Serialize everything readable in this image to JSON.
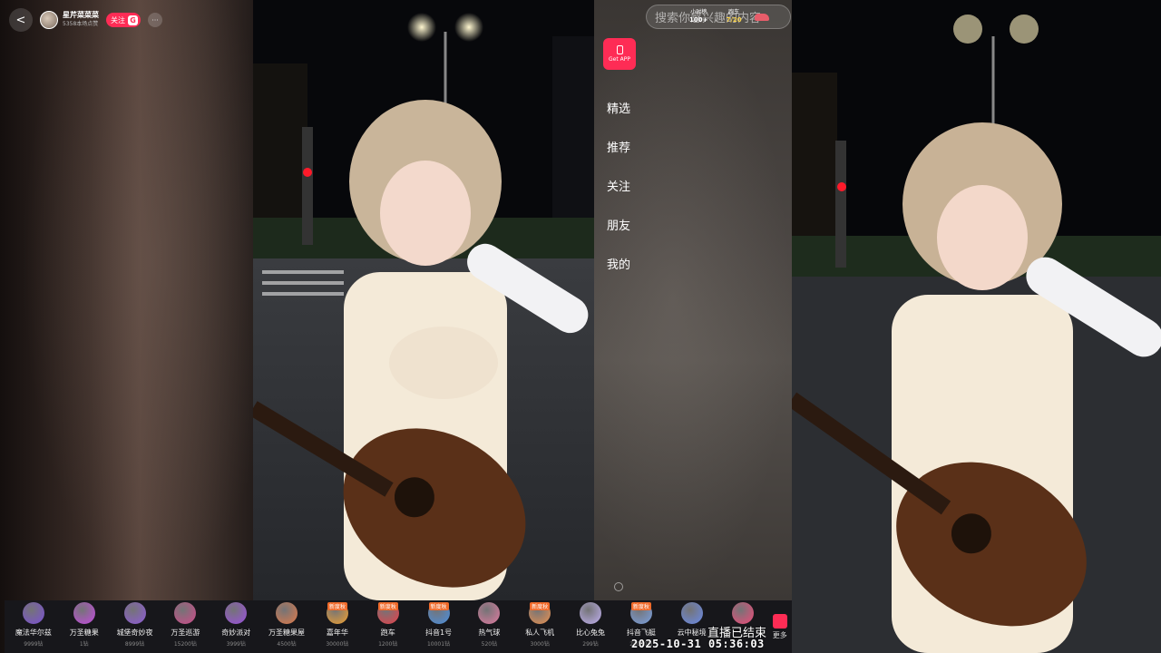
{
  "header": {
    "back": "<",
    "anchor_name": "星芹菜菜菜",
    "anchor_sub": "5358本场点赞",
    "follow_label": "关注",
    "follow_badge": "G",
    "more": "···"
  },
  "get_app": {
    "label": "Get APP"
  },
  "search": {
    "text": "搜索你感兴趣的内容"
  },
  "rank": {
    "hourly_label": "小时榜",
    "hourly_value": "100+",
    "team_label": "跑车",
    "team_value": "7/20"
  },
  "menu": {
    "items": [
      "精选",
      "推荐",
      "关注",
      "朋友",
      "我的"
    ]
  },
  "gifts": [
    {
      "name": "魔法华尔兹",
      "price": "9999钻",
      "tag": "",
      "color": "#7b4fd6"
    },
    {
      "name": "万圣糖果",
      "price": "1钻",
      "tag": "",
      "color": "#c54ae0"
    },
    {
      "name": "城堡奇妙夜",
      "price": "8999钻",
      "tag": "",
      "color": "#8f5ad9"
    },
    {
      "name": "万圣巡游",
      "price": "15200钻",
      "tag": "",
      "color": "#d04a8a"
    },
    {
      "name": "奇妙派对",
      "price": "3999钻",
      "tag": "",
      "color": "#9b4fe0"
    },
    {
      "name": "万圣糖果屋",
      "price": "4500钻",
      "tag": "",
      "color": "#e07a4a"
    },
    {
      "name": "嘉年华",
      "price": "30000钻",
      "tag": "新度秋",
      "color": "#f0a030"
    },
    {
      "name": "跑车",
      "price": "1200钻",
      "tag": "新度秋",
      "color": "#e8404a"
    },
    {
      "name": "抖音1号",
      "price": "10001钻",
      "tag": "新度秋",
      "color": "#4a8fe0"
    },
    {
      "name": "热气球",
      "price": "520钻",
      "tag": "",
      "color": "#e07aa0"
    },
    {
      "name": "私人飞机",
      "price": "3000钻",
      "tag": "新度秋",
      "color": "#e89050"
    },
    {
      "name": "比心兔兔",
      "price": "299钻",
      "tag": "",
      "color": "#c0b0f0"
    },
    {
      "name": "抖音飞艇",
      "price": "20000钻",
      "tag": "新度秋",
      "color": "#7aa0e0"
    },
    {
      "name": "云中秘境",
      "price": "",
      "tag": "",
      "color": "#6a8ae8"
    },
    {
      "name": "",
      "price": "",
      "tag": "",
      "color": "#f04a7a"
    }
  ],
  "gift_more": "更多",
  "overlay": {
    "end_text": "直播已结束",
    "timestamp": "2025-10-31 05:36:03"
  }
}
